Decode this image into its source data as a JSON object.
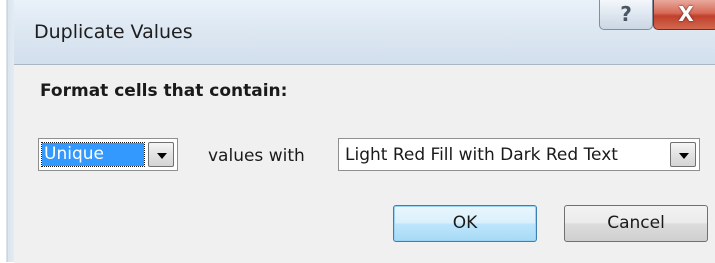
{
  "window": {
    "title": "Duplicate Values",
    "help_glyph": "?",
    "close_glyph": "X",
    "icons": {
      "help": "help-icon",
      "close": "close-icon"
    }
  },
  "section": {
    "title": "Format cells that contain:"
  },
  "rule": {
    "selected": "Unique",
    "options_visible": [
      "Unique"
    ]
  },
  "connector_label": "values with",
  "format": {
    "selected": "Light Red Fill with Dark Red Text"
  },
  "buttons": {
    "ok": "OK",
    "cancel": "Cancel"
  },
  "colors": {
    "selection_highlight": "#3399ff",
    "close_button": "#c0402c",
    "dialog_background": "#f0f0f0"
  }
}
